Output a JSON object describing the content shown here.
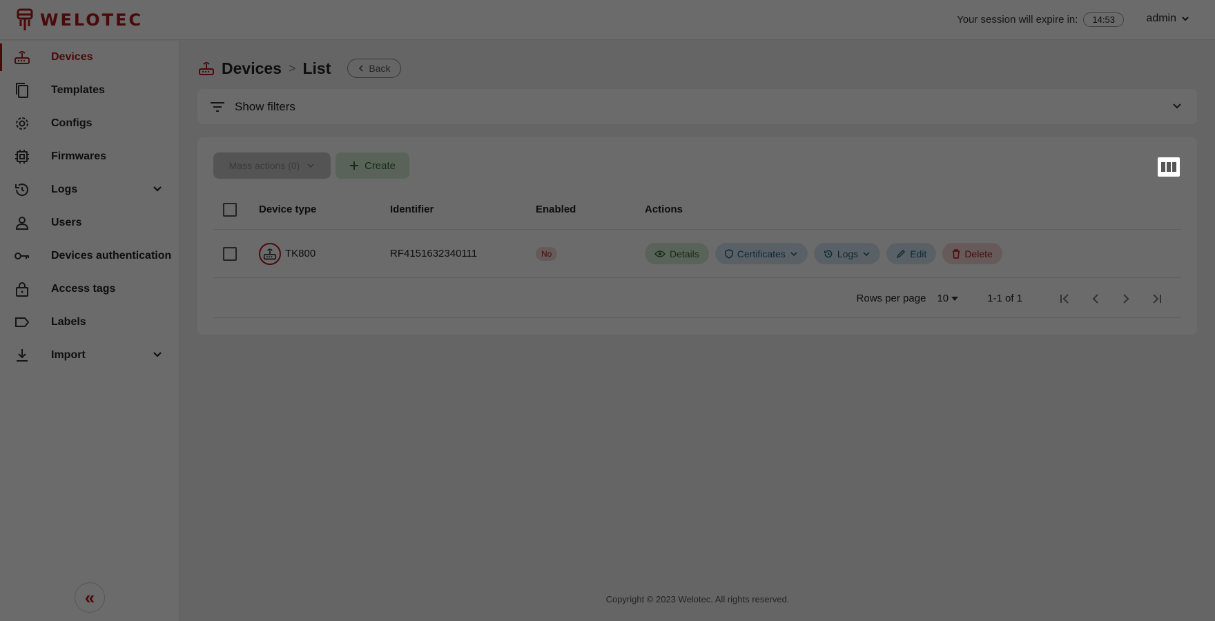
{
  "brand": {
    "name": "WELOTEC",
    "accent": "#b01a1a"
  },
  "header": {
    "session_label": "Your session will expire in:",
    "session_time": "14:53",
    "user": "admin"
  },
  "sidebar": {
    "items": [
      {
        "label": "Devices",
        "icon": "router-icon",
        "active": true
      },
      {
        "label": "Templates",
        "icon": "copy-icon"
      },
      {
        "label": "Configs",
        "icon": "gear-icon"
      },
      {
        "label": "Firmwares",
        "icon": "chip-icon"
      },
      {
        "label": "Logs",
        "icon": "history-icon",
        "expandable": true
      },
      {
        "label": "Users",
        "icon": "person-icon"
      },
      {
        "label": "Devices authentication",
        "icon": "key-icon"
      },
      {
        "label": "Access tags",
        "icon": "lock-icon"
      },
      {
        "label": "Labels",
        "icon": "label-icon"
      },
      {
        "label": "Import",
        "icon": "download-icon",
        "expandable": true
      }
    ],
    "collapse_glyph": "«"
  },
  "breadcrumb": {
    "section": "Devices",
    "separator": ">",
    "page": "List",
    "back": "Back"
  },
  "filters": {
    "label": "Show filters"
  },
  "toolbar": {
    "mass_actions": "Mass actions (0)",
    "create": "Create"
  },
  "table": {
    "columns": [
      "Device type",
      "Identifier",
      "Enabled",
      "Actions"
    ],
    "rows": [
      {
        "type": "TK800",
        "identifier": "RF4151632340111",
        "enabled": "No",
        "actions": {
          "details": "Details",
          "certificates": "Certificates",
          "logs": "Logs",
          "edit": "Edit",
          "delete": "Delete"
        }
      }
    ]
  },
  "pagination": {
    "rows_per_page_label": "Rows per page",
    "rows_per_page": "10",
    "range": "1-1 of 1"
  },
  "footer": {
    "copyright": "Copyright © 2023 Welotec. All rights reserved."
  }
}
